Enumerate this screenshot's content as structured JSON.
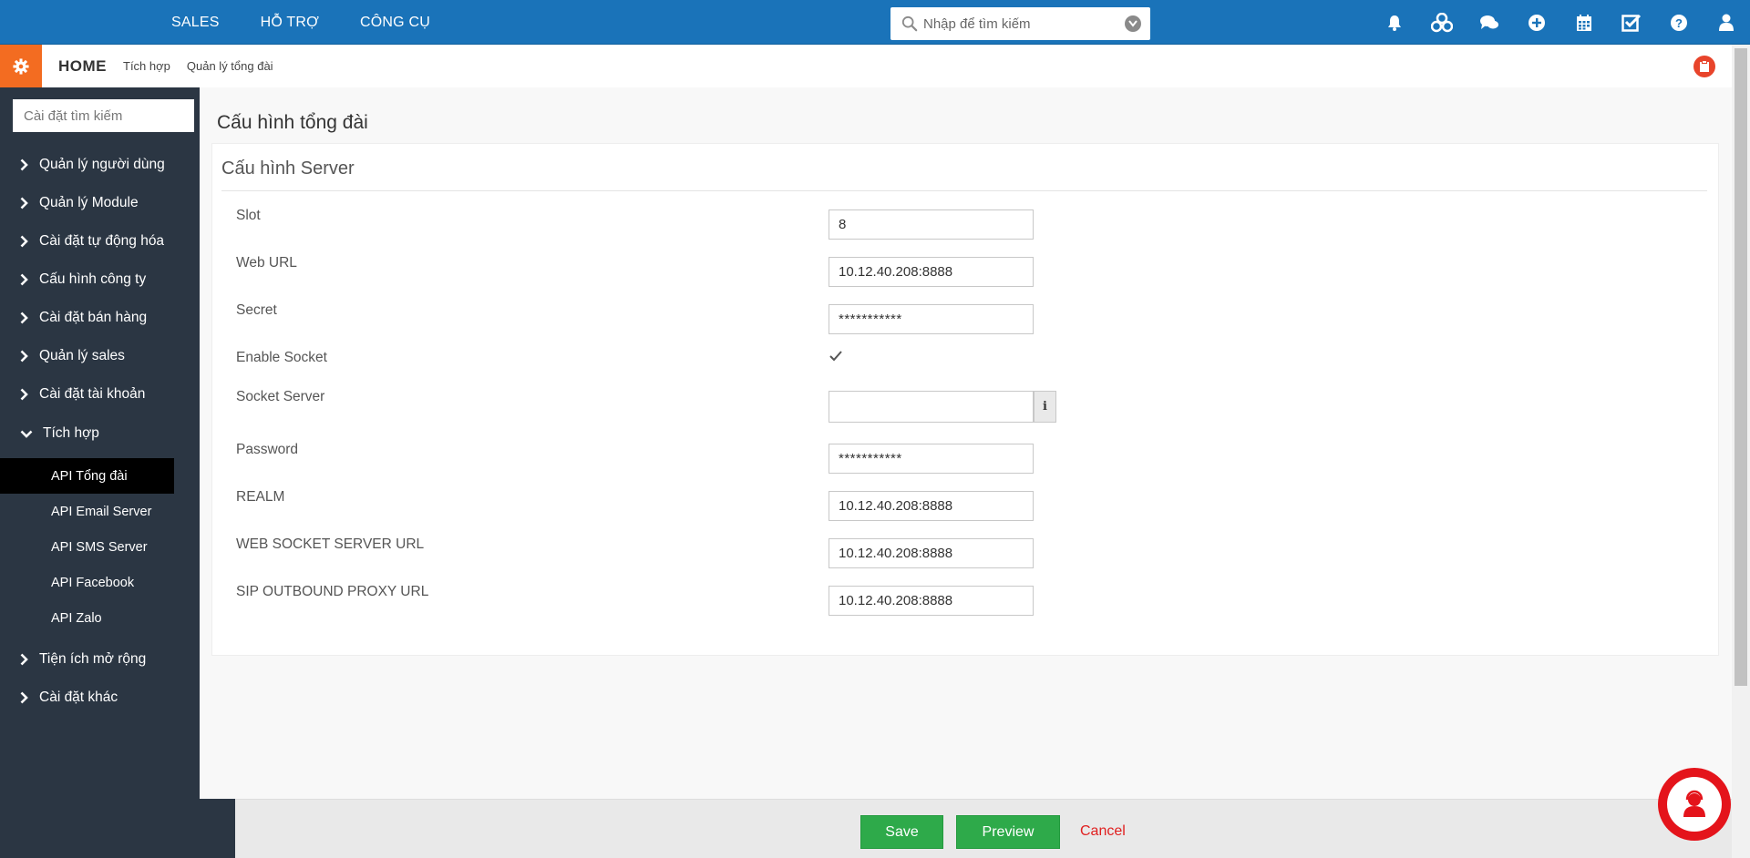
{
  "topnav": {
    "items": [
      {
        "label": "SALES"
      },
      {
        "label": "HỖ TRỢ"
      },
      {
        "label": "CÔNG CỤ"
      }
    ],
    "search_placeholder": "Nhập để tìm kiếm"
  },
  "breadcrumb": {
    "home": "HOME",
    "items": [
      "Tích hợp",
      "Quản lý tổng đài"
    ]
  },
  "sidebar": {
    "search_placeholder": "Cài đặt tìm kiếm",
    "items": [
      {
        "label": "Quản lý người dùng"
      },
      {
        "label": "Quản lý Module"
      },
      {
        "label": "Cài đặt tự động hóa"
      },
      {
        "label": "Cấu hình công ty"
      },
      {
        "label": "Cài đặt bán hàng"
      },
      {
        "label": "Quản lý sales"
      },
      {
        "label": "Cài đặt tài khoản"
      },
      {
        "label": "Tích hợp"
      },
      {
        "label": "Tiện ích mở rộng"
      },
      {
        "label": "Cài đặt khác"
      }
    ],
    "sub_items": [
      {
        "label": "API Tổng đài"
      },
      {
        "label": "API Email Server"
      },
      {
        "label": "API SMS Server"
      },
      {
        "label": "API Facebook"
      },
      {
        "label": "API Zalo"
      }
    ]
  },
  "main": {
    "page_title": "Cấu hình tổng đài",
    "section_title": "Cấu hình Server",
    "fields": {
      "slot": {
        "label": "Slot",
        "value": "8"
      },
      "web_url": {
        "label": "Web URL",
        "value": "10.12.40.208:8888"
      },
      "secret": {
        "label": "Secret",
        "value": "***********"
      },
      "enable_socket": {
        "label": "Enable Socket",
        "checked": true
      },
      "socket_server": {
        "label": "Socket Server",
        "value": "",
        "info": "i"
      },
      "password": {
        "label": "Password",
        "value": "***********"
      },
      "realm": {
        "label": "REALM",
        "value": "10.12.40.208:8888"
      },
      "ws_url": {
        "label": "WEB SOCKET SERVER URL",
        "value": "10.12.40.208:8888"
      },
      "sip_url": {
        "label": "SIP OUTBOUND PROXY URL",
        "value": "10.12.40.208:8888"
      }
    }
  },
  "footer": {
    "save_label": "Save",
    "preview_label": "Preview",
    "cancel_label": "Cancel"
  },
  "colors": {
    "topbar": "#1a73b9",
    "sidebar": "#2b3643",
    "accent_orange": "#f36c21",
    "button_green": "#2eaa4a",
    "cancel_red": "#e02020"
  }
}
